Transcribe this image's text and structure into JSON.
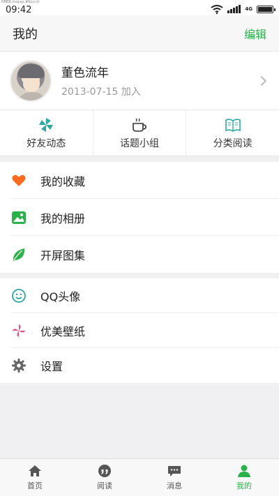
{
  "status_bar": {
    "tiny_text": "RBBB.mopay,#&Lo.nt",
    "time": "09:42",
    "network": "4G"
  },
  "header": {
    "title": "我的",
    "edit_label": "编辑"
  },
  "profile": {
    "name": "董色流年",
    "joined": "2013-07-15 加入"
  },
  "quick_actions": [
    {
      "label": "好友动态",
      "icon": "pinwheel-icon"
    },
    {
      "label": "话题小组",
      "icon": "coffee-cup-icon"
    },
    {
      "label": "分类阅读",
      "icon": "open-book-icon"
    }
  ],
  "list_group_1": [
    {
      "label": "我的收藏",
      "icon": "heart-icon"
    },
    {
      "label": "我的相册",
      "icon": "photo-album-icon"
    },
    {
      "label": "开屏图集",
      "icon": "leaf-icon"
    }
  ],
  "list_group_2": [
    {
      "label": "QQ头像",
      "icon": "smile-face-icon"
    },
    {
      "label": "优美壁纸",
      "icon": "pinwheel-icon"
    },
    {
      "label": "设置",
      "icon": "gear-icon"
    }
  ],
  "tabbar": [
    {
      "label": "首页",
      "icon": "home-icon"
    },
    {
      "label": "阅读",
      "icon": "quote-bubble-icon"
    },
    {
      "label": "消息",
      "icon": "message-icon"
    },
    {
      "label": "我的",
      "icon": "person-icon",
      "active": true
    }
  ],
  "colors": {
    "accent": "#2ab24a",
    "heart": "#ff6a1f",
    "teal": "#2aa9a3",
    "pink": "#e64f86"
  }
}
